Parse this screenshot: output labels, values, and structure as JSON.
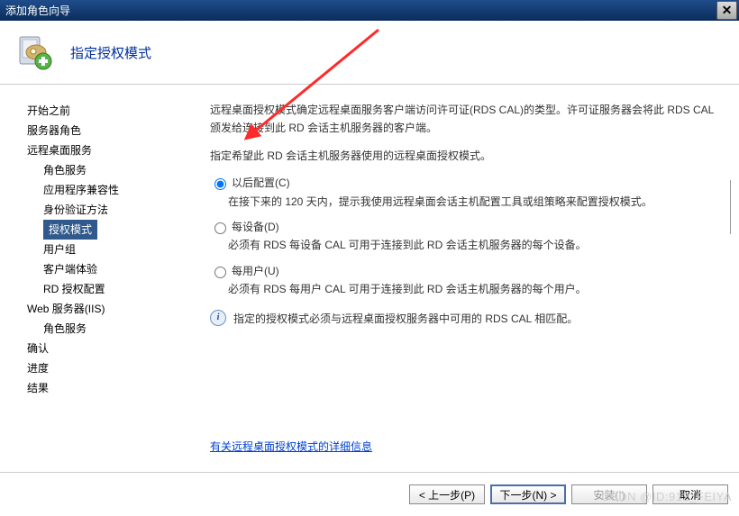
{
  "title": "添加角色向导",
  "header": {
    "title": "指定授权模式"
  },
  "sidebar": {
    "items": [
      "开始之前",
      "服务器角色",
      "远程桌面服务",
      "角色服务",
      "应用程序兼容性",
      "身份验证方法",
      "授权模式",
      "用户组",
      "客户端体验",
      "RD 授权配置",
      "Web 服务器(IIS)",
      "角色服务",
      "确认",
      "进度",
      "结果"
    ]
  },
  "content": {
    "p1": "远程桌面授权模式确定远程桌面服务客户端访问许可证(RDS CAL)的类型。许可证服务器会将此 RDS CAL 颁发给连接到此 RD 会话主机服务器的客户端。",
    "p2a": "指定希望此 RD 会话主机服务器使用的远程桌面授权模式。",
    "opt1": {
      "label": "以后配置(C)",
      "desc": "在接下来的 120 天内，提示我使用远程桌面会话主机配置工具或组策略来配置授权模式。"
    },
    "opt2": {
      "label": "每设备(D)",
      "desc": "必须有 RDS 每设备 CAL 可用于连接到此 RD 会话主机服务器的每个设备。"
    },
    "opt3": {
      "label": "每用户(U)",
      "desc": "必须有 RDS 每用户 CAL 可用于连接到此 RD 会话主机服务器的每个用户。"
    },
    "info": "指定的授权模式必须与远程桌面授权服务器中可用的 RDS CAL 相匹配。",
    "link": "有关远程桌面授权模式的详细信息"
  },
  "footer": {
    "prev": "< 上一步(P)",
    "next": "下一步(N) >",
    "install": "安装(I)",
    "cancel": "取消"
  },
  "watermark": "CSDN @ID:912_FEIYA"
}
